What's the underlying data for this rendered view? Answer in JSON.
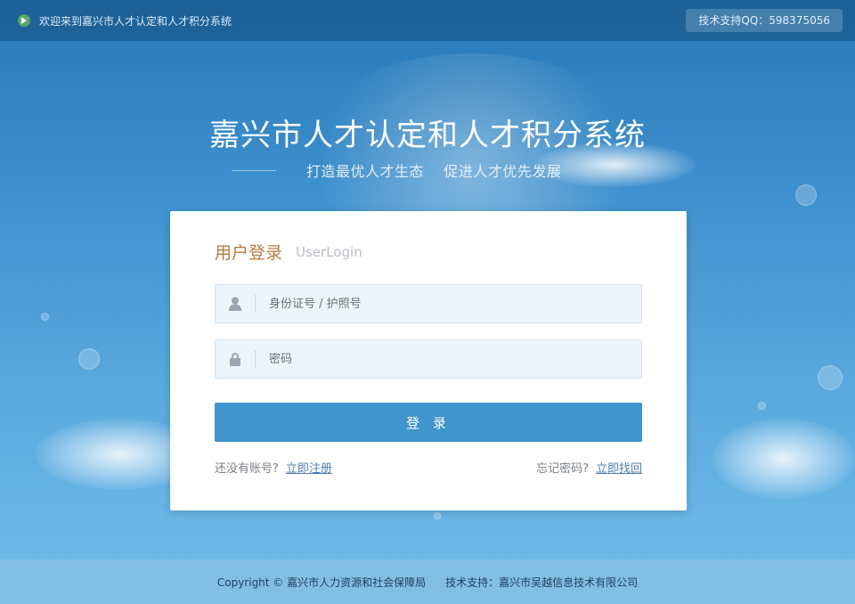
{
  "topbar": {
    "welcome": "欢迎来到嘉兴市人才认定和人才积分系统",
    "support": "技术支持QQ：598375056"
  },
  "hero": {
    "title": "嘉兴市人才认定和人才积分系统",
    "subtitle": "打造最优人才生态    促进人才优先发展"
  },
  "login": {
    "title": "用户登录",
    "subtitle": "UserLogin",
    "id_placeholder": "身份证号 / 护照号",
    "password_placeholder": "密码",
    "submit_label": "登 录",
    "no_account_text": "还没有账号?",
    "register_link": "立即注册",
    "forgot_text": "忘记密码?",
    "recover_link": "立即找回"
  },
  "footer": {
    "copyright": "Copyright © 嘉兴市人力资源和社会保障局",
    "tech_support": "技术支持：嘉兴市吴越信息技术有限公司"
  },
  "colors": {
    "accent": "#3f95cc",
    "title_brown": "#b57c3e",
    "link_blue": "#4a7fb5"
  }
}
